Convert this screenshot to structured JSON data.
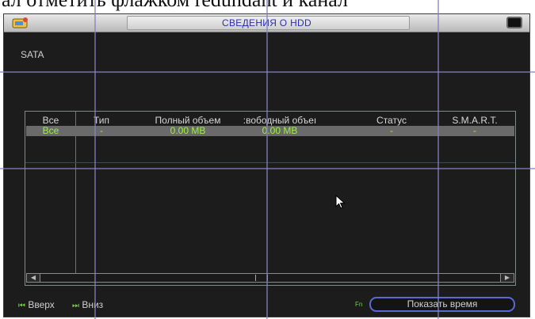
{
  "document": {
    "line_above": "ал отметить флажком redundant и канал"
  },
  "window": {
    "title": "СВЕДЕНИЯ О HDD"
  },
  "device_label": "SATA",
  "table": {
    "columns": [
      "Все",
      "Тип",
      "Полный объем",
      ":вободный объеı",
      "Статус",
      "S.M.A.R.T."
    ],
    "rows": [
      [
        "Все",
        "-",
        "0.00 MB",
        "0.00 MB",
        "-",
        "-"
      ]
    ]
  },
  "footer": {
    "up_label": "Вверх",
    "down_label": "Вниз",
    "fn_label": "Fn",
    "show_time_label": "Показать время"
  },
  "colors": {
    "accent_green": "#9cf23e",
    "title_text": "#2a2fb0",
    "button_border": "#5a6ad0"
  },
  "icons": {
    "up": "skip-back-icon",
    "down": "skip-forward-icon",
    "scroll_left": "arrow-left-icon",
    "scroll_right": "arrow-right-icon"
  }
}
